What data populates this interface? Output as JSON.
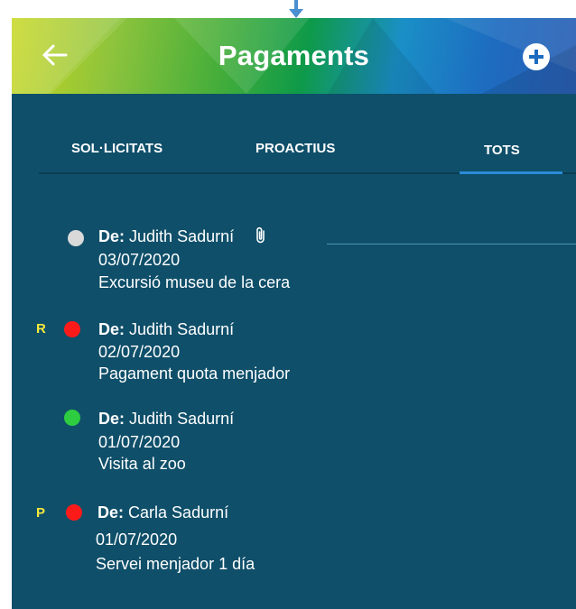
{
  "header": {
    "title": "Pagaments"
  },
  "tabs": [
    {
      "label": "SOL·LICITATS"
    },
    {
      "label": "PROACTIUS"
    },
    {
      "label": "TOTS",
      "active": true
    }
  ],
  "items": [
    {
      "flag": "",
      "status_color": "#d9d9d9",
      "from_label": "De:",
      "from": "Judith Sadurní",
      "attachment": true,
      "date": "03/07/2020",
      "subject": "Excursió museu de la cera"
    },
    {
      "flag": "R",
      "status_color": "#ff1a1a",
      "from_label": "De:",
      "from": "Judith Sadurní",
      "attachment": false,
      "date": "02/07/2020",
      "subject": "Pagament quota menjador"
    },
    {
      "flag": "",
      "status_color": "#2ecc40",
      "from_label": "De:",
      "from": "Judith Sadurní",
      "attachment": false,
      "date": "01/07/2020",
      "subject": "Visita al zoo"
    },
    {
      "flag": "P",
      "status_color": "#ff1a1a",
      "from_label": "De:",
      "from": "Carla Sadurní",
      "attachment": false,
      "date": "01/07/2020",
      "subject": "Servei menjador 1 día"
    }
  ],
  "icons": {
    "back": "arrow-left-icon",
    "add": "plus-circle-icon",
    "attachment": "paperclip-icon",
    "top_arrow": "arrow-down-icon"
  },
  "colors": {
    "background": "#0f4f6a",
    "tab_indicator": "#2a8bd8",
    "flag": "#f5e83a"
  }
}
